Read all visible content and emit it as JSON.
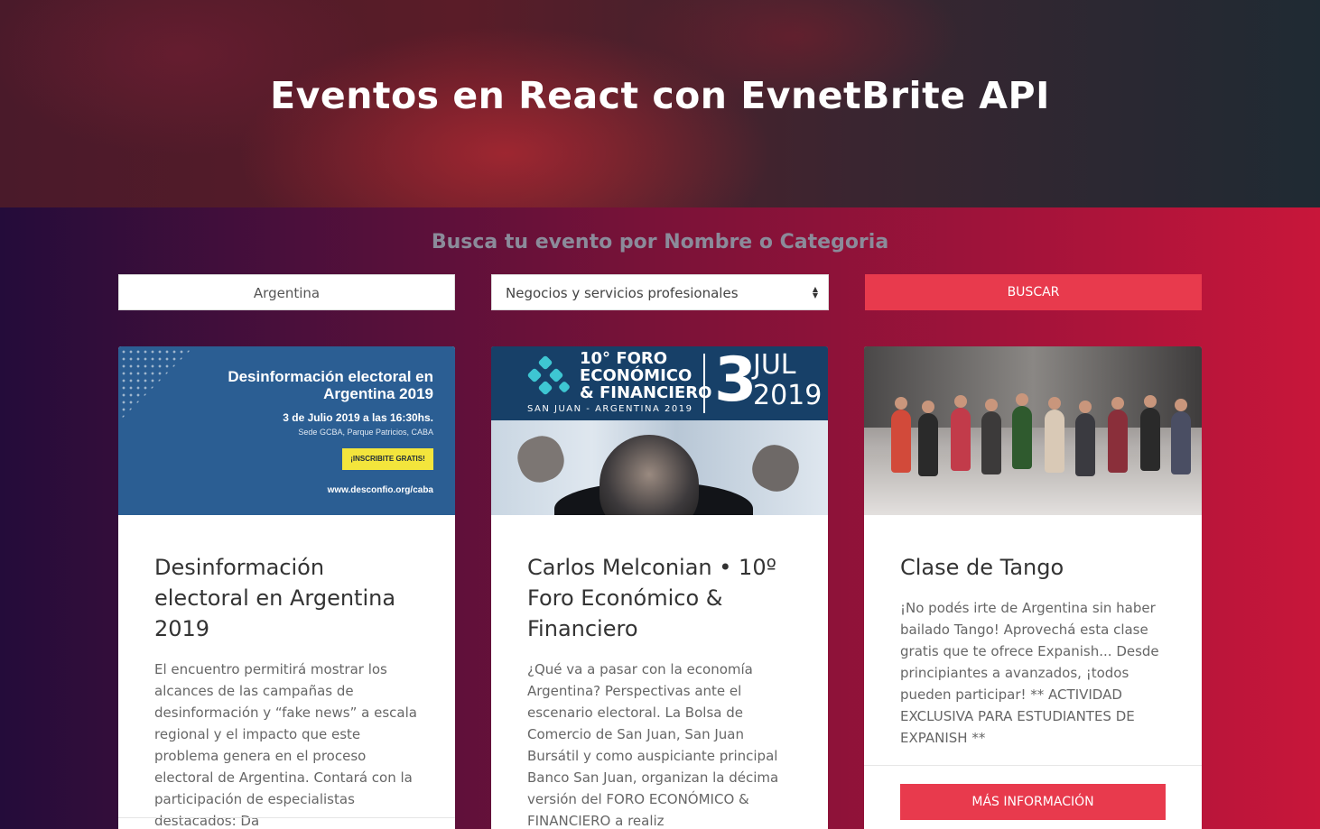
{
  "header": {
    "title": "Eventos en React con EvnetBrite API"
  },
  "search": {
    "subtitle": "Busca tu evento por Nombre o Categoria",
    "country_value": "Argentina",
    "category_selected": "Negocios y servicios profesionales",
    "button_label": "BUSCAR"
  },
  "events": [
    {
      "title": "Desinformación electoral en Argentina 2019",
      "description": "El encuentro permitirá mostrar los alcances de las campañas de desinformación y “fake news” a escala regional y el impacto que este problema genera en el proceso electoral de Argentina. Contará con la participación de especialistas destacados: Da",
      "image": {
        "heading": "Desinformación electoral en Argentina 2019",
        "date": "3 de Julio 2019 a las 16:30hs.",
        "venue": "Sede GCBA, Parque Patricios, CABA",
        "badge": "¡INSCRIBITE GRATIS!",
        "url": "www.desconfio.org/caba"
      }
    },
    {
      "title": "Carlos Melconian • 10º Foro Económico & Financiero",
      "description": "¿Qué va a pasar con la economía Argentina? Perspectivas ante el escenario electoral. La Bolsa de Comercio de San Juan, San Juan Bursátil y como auspiciante principal Banco San Juan, organizan la décima versión del FORO ECONÓMICO & FINANCIERO a realiz",
      "image": {
        "line1": "10° FORO",
        "line2": "ECONÓMICO",
        "line3": "& FINANCIERO",
        "location": "SAN JUAN - ARGENTINA 2019",
        "day": "3",
        "month": "JUL",
        "year": "2019"
      }
    },
    {
      "title": "Clase de Tango",
      "description": "¡No podés irte de Argentina sin haber bailado Tango! Aprovechá esta clase gratis que te ofrece Expanish... Desde principiantes a avanzados, ¡todos pueden participar!  ** ACTIVIDAD EXCLUSIVA PARA ESTUDIANTES DE EXPANISH **",
      "button_label": "MÁS INFORMACIÓN"
    }
  ],
  "colors": {
    "accent": "#e83a4d",
    "gradient_left": "#240c3a",
    "gradient_right": "#c8163a"
  }
}
